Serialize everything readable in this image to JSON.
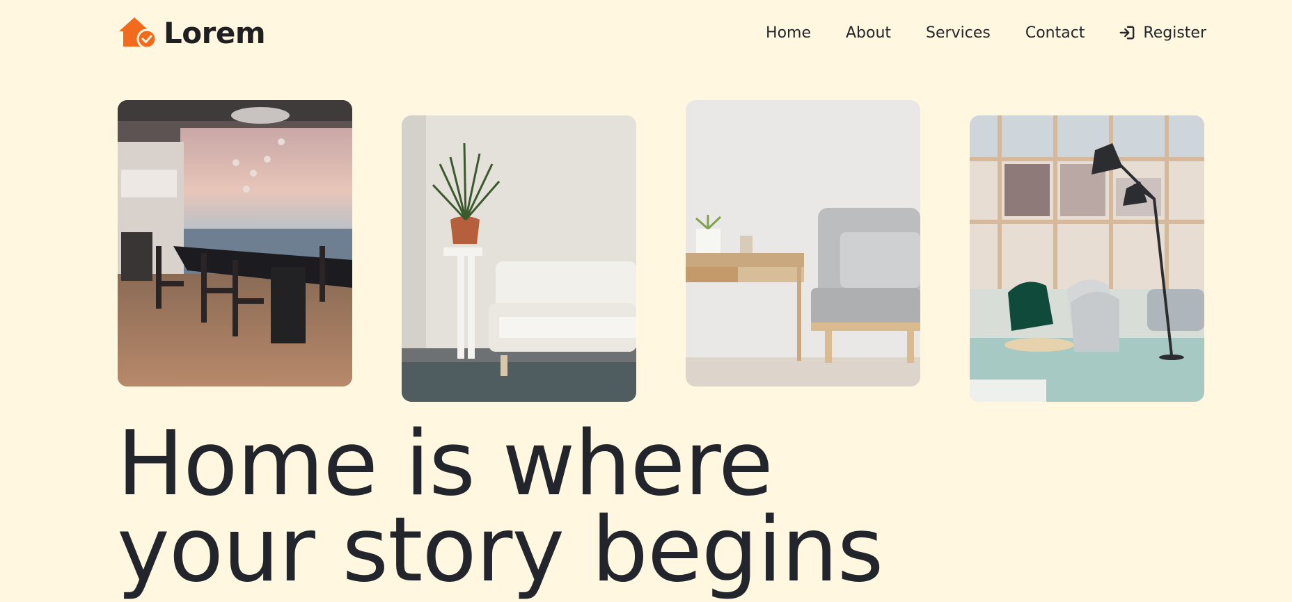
{
  "brand": {
    "name": "Lorem",
    "logo_icon": "house-check-icon",
    "accent_color": "#f26a1b"
  },
  "nav": {
    "items": [
      {
        "label": "Home"
      },
      {
        "label": "About"
      },
      {
        "label": "Services"
      },
      {
        "label": "Contact"
      }
    ],
    "register": {
      "label": "Register",
      "icon": "sign-in-icon"
    }
  },
  "gallery": {
    "images": [
      {
        "subject": "dining-room-sea-view"
      },
      {
        "subject": "white-sofa-with-plant"
      },
      {
        "subject": "grey-armchair-and-desk"
      },
      {
        "subject": "lounge-with-floor-lamp"
      }
    ]
  },
  "hero": {
    "title_line1": "Home is where",
    "title_line2": "your story begins"
  },
  "colors": {
    "background": "#fff7df",
    "text": "#22262c"
  }
}
